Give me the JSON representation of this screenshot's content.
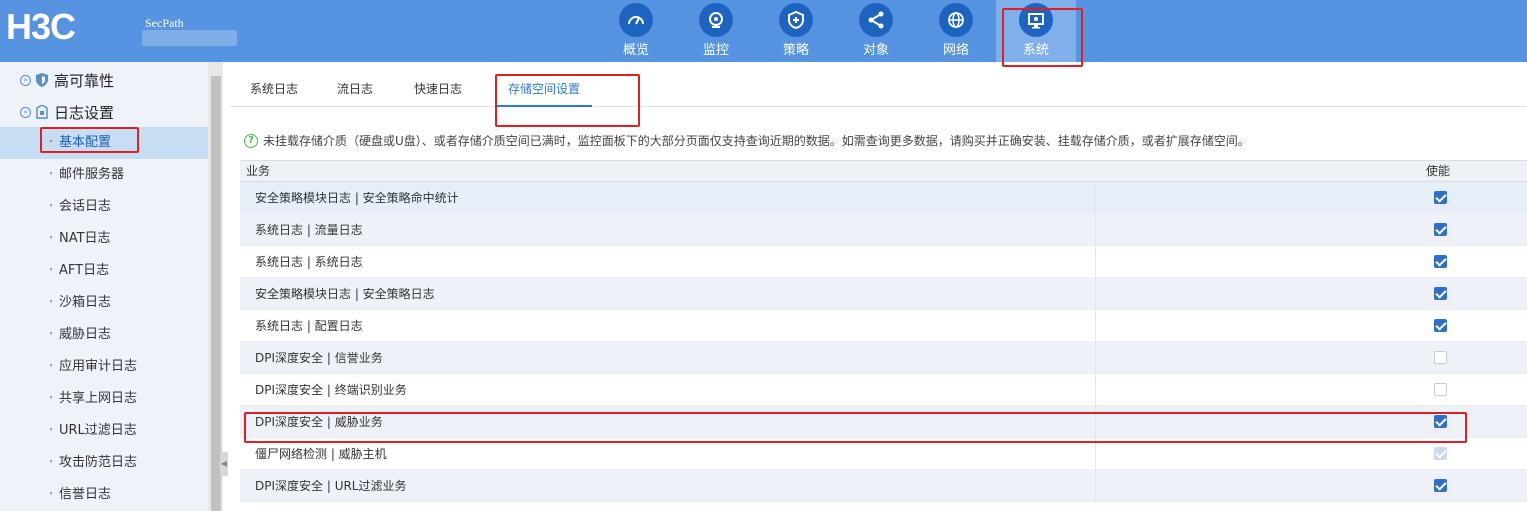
{
  "header": {
    "logo": "H3C",
    "product": "SecPath",
    "nav": [
      {
        "label": "概览",
        "icon": "gauge-icon"
      },
      {
        "label": "监控",
        "icon": "camera-icon"
      },
      {
        "label": "策略",
        "icon": "shield-plus-icon"
      },
      {
        "label": "对象",
        "icon": "share-icon"
      },
      {
        "label": "网络",
        "icon": "globe-icon"
      },
      {
        "label": "系统",
        "icon": "monitor-icon",
        "active": true
      }
    ]
  },
  "sidebar": {
    "groups": [
      {
        "label": "高可靠性",
        "toggle": "»",
        "icon": "shield-icon"
      },
      {
        "label": "日志设置",
        "toggle": "«",
        "icon": "log-icon"
      }
    ],
    "items": [
      {
        "label": "基本配置",
        "active": true
      },
      {
        "label": "邮件服务器"
      },
      {
        "label": "会话日志"
      },
      {
        "label": "NAT日志"
      },
      {
        "label": "AFT日志"
      },
      {
        "label": "沙箱日志"
      },
      {
        "label": "威胁日志"
      },
      {
        "label": "应用审计日志"
      },
      {
        "label": "共享上网日志"
      },
      {
        "label": "URL过滤日志"
      },
      {
        "label": "攻击防范日志"
      },
      {
        "label": "信誉日志"
      }
    ]
  },
  "tabs": [
    {
      "label": "系统日志"
    },
    {
      "label": "流日志"
    },
    {
      "label": "快速日志"
    },
    {
      "label": "存储空间设置",
      "active": true
    }
  ],
  "notice": "未挂载存储介质（硬盘或U盘）、或者存储介质空间已满时，监控面板下的大部分页面仅支持查询近期的数据。如需查询更多数据，请购买并正确安装、挂载存储介质，或者扩展存储空间。",
  "table": {
    "headers": {
      "service": "业务",
      "enable": "使能"
    },
    "rows": [
      {
        "name": "安全策略模块日志 | 安全策略命中统计",
        "state": "checked"
      },
      {
        "name": "系统日志 | 流量日志",
        "state": "checked"
      },
      {
        "name": "系统日志 | 系统日志",
        "state": "checked"
      },
      {
        "name": "安全策略模块日志 | 安全策略日志",
        "state": "checked"
      },
      {
        "name": "系统日志 | 配置日志",
        "state": "checked"
      },
      {
        "name": "DPI深度安全 | 信誉业务",
        "state": "unchecked"
      },
      {
        "name": "DPI深度安全 | 终端识别业务",
        "state": "unchecked"
      },
      {
        "name": "DPI深度安全 | 威胁业务",
        "state": "checked"
      },
      {
        "name": "僵尸网络检测 | 威胁主机",
        "state": "disabled"
      },
      {
        "name": "DPI深度安全 | URL过滤业务",
        "state": "checked"
      }
    ]
  },
  "colors": {
    "topbar": "#5693e0",
    "accent": "#2f78d6",
    "highlight": "#e02020"
  }
}
